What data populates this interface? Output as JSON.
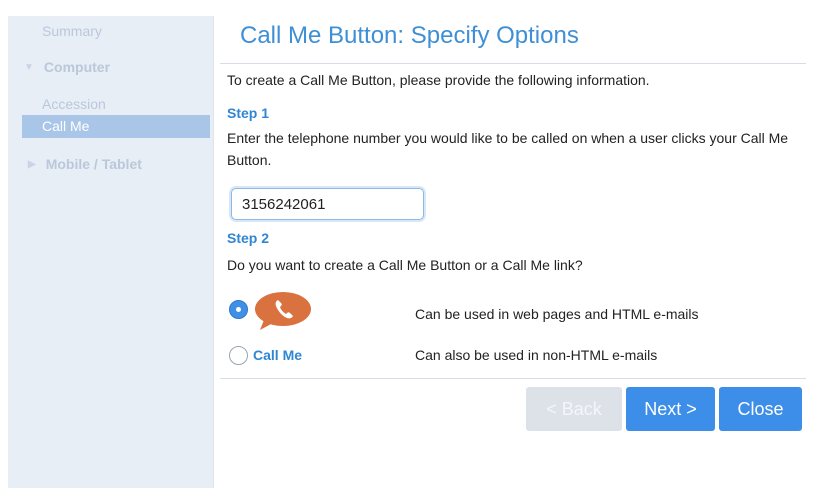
{
  "sidebar": {
    "summary": "Summary",
    "computer": "Computer",
    "accession": "Accession",
    "call_me": "Call Me",
    "mobile": "Mobile / Tablet"
  },
  "main": {
    "title": "Call Me Button: Specify Options",
    "intro": "To create a Call Me Button, please provide the following information.",
    "step1_label": "Step 1",
    "step1_desc": "Enter the telephone number you would like to be called on when a user clicks your Call Me Button.",
    "phone_value": "3156242061",
    "step2_label": "Step 2",
    "step2_desc": "Do you want to create a Call Me Button or a Call Me link?",
    "options": [
      {
        "label": "",
        "icon": "phone-bubble-icon",
        "description": "Can be used in web pages and HTML e-mails",
        "selected": true
      },
      {
        "label": "Call Me",
        "description": "Can also be used in non-HTML e-mails",
        "selected": false
      }
    ]
  },
  "footer": {
    "back": "< Back",
    "next": "Next >",
    "close": "Close"
  },
  "colors": {
    "accent": "#3d8ee8",
    "title": "#3f8fd6",
    "bubble": "#d9723f"
  }
}
